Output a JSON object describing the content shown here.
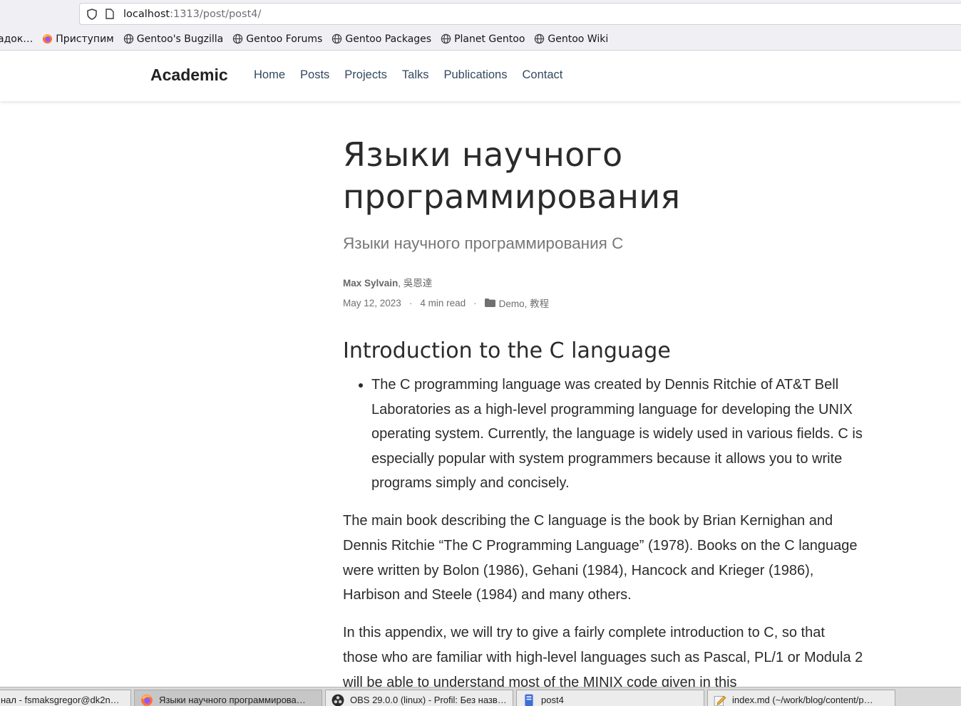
{
  "browser": {
    "url_host": "localhost",
    "url_path": ":1313/post/post4/",
    "bookmarks": [
      {
        "label": "адок…",
        "icon": "folder-icon"
      },
      {
        "label": "Приступим",
        "icon": "firefox-icon"
      },
      {
        "label": "Gentoo's Bugzilla",
        "icon": "globe-icon"
      },
      {
        "label": "Gentoo Forums",
        "icon": "globe-icon"
      },
      {
        "label": "Gentoo Packages",
        "icon": "globe-icon"
      },
      {
        "label": "Planet Gentoo",
        "icon": "globe-icon"
      },
      {
        "label": "Gentoo Wiki",
        "icon": "globe-icon"
      }
    ]
  },
  "site": {
    "brand": "Academic",
    "nav": [
      "Home",
      "Posts",
      "Projects",
      "Talks",
      "Publications",
      "Contact"
    ]
  },
  "article": {
    "title": "Языки научного программирования",
    "subtitle": "Языки научного программирования C",
    "author_main": "Max Sylvain",
    "author_rest": ", 吳恩達",
    "date": "May 12, 2023",
    "read_time": "4 min read",
    "categories": "Demo, 教程",
    "heading": "Introduction to the C language",
    "bullet": "The C programming language was created by Dennis Ritchie of AT&T Bell Laboratories as a high-level programming language for developing the UNIX operating system. Currently, the language is widely used in various fields. C is especially popular with system programmers because it allows you to write programs simply and concisely.",
    "para1": "The main book describing the C language is the book by Brian Kernighan and Dennis Ritchie “The C Programming Language” (1978). Books on the C language were written by Bolon (1986), Gehani (1984), Hancock and Krieger (1986), Harbison and Steele (1984) and many others.",
    "para2": "In this appendix, we will try to give a fairly complete introduction to C, so that those who are familiar with high-level languages such as Pascal, PL/1 or Modula 2 will be able to understand most of the MINIX code given in this"
  },
  "taskbar": [
    {
      "label": "нал - fsmaksgregor@dk2n…",
      "icon": "terminal-icon",
      "active": false
    },
    {
      "label": "Языки научного программирова…",
      "icon": "firefox-icon",
      "active": true
    },
    {
      "label": "OBS 29.0.0 (linux) - Profil: Без назв…",
      "icon": "obs-icon",
      "active": false
    },
    {
      "label": "post4",
      "icon": "file-manager-icon",
      "active": false
    },
    {
      "label": "index.md (~/work/blog/content/p…",
      "icon": "text-editor-icon",
      "active": false
    }
  ]
}
